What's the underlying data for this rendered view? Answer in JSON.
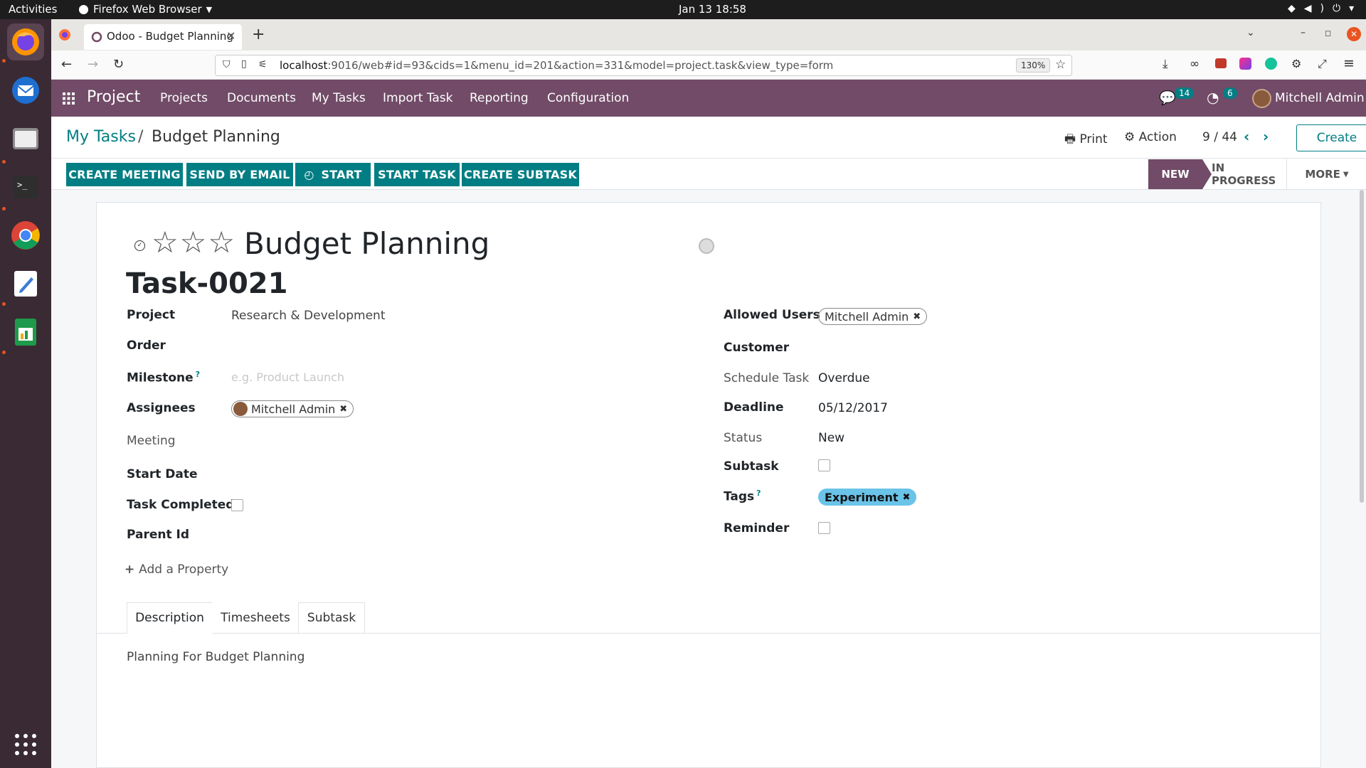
{
  "os": {
    "activities": "Activities",
    "app_name": "Firefox Web Browser",
    "datetime": "Jan 13  18:58"
  },
  "browser": {
    "tab_title": "Odoo - Budget Planning",
    "url_host": "localhost",
    "url_rest": ":9016/web#id=93&cids=1&menu_id=201&action=331&model=project.task&view_type=form",
    "zoom": "130%"
  },
  "odoo_nav": {
    "app": "Project",
    "items": [
      "Projects",
      "Documents",
      "My Tasks",
      "Import Task",
      "Reporting",
      "Configuration"
    ],
    "messages_count": "14",
    "activities_count": "6",
    "user": "Mitchell Admin"
  },
  "breadcrumb": {
    "parent": "My Tasks",
    "separator": "/",
    "current": "Budget Planning"
  },
  "toolbar": {
    "print": "Print",
    "action": "Action",
    "pager": "9 / 44",
    "create": "Create"
  },
  "buttons": {
    "create_meeting": "CREATE MEETING",
    "send_email": "SEND BY EMAIL",
    "start": "START",
    "start_task": "START TASK",
    "create_subtask": "CREATE SUBTASK"
  },
  "stages": {
    "new": "NEW",
    "in_progress": "IN PROGRESS",
    "more": "MORE"
  },
  "task": {
    "name": "Budget Planning",
    "reference": "Task-0021",
    "stars": 0
  },
  "left_fields": {
    "project_label": "Project",
    "project_value": "Research & Development",
    "order_label": "Order",
    "milestone_label": "Milestone",
    "milestone_placeholder": "e.g. Product Launch",
    "assignees_label": "Assignees",
    "assignee": "Mitchell Admin",
    "meeting_label": "Meeting",
    "start_date_label": "Start Date",
    "task_completed_label": "Task Completed",
    "parent_id_label": "Parent Id",
    "add_property": "Add a Property"
  },
  "right_fields": {
    "allowed_users_label": "Allowed Users",
    "allowed_user": "Mitchell Admin",
    "customer_label": "Customer",
    "schedule_label": "Schedule Task",
    "schedule_value": "Overdue",
    "deadline_label": "Deadline",
    "deadline_value": "05/12/2017",
    "status_label": "Status",
    "status_value": "New",
    "subtask_label": "Subtask",
    "tags_label": "Tags",
    "tag": "Experiment",
    "reminder_label": "Reminder"
  },
  "notebook": {
    "tabs": [
      "Description",
      "Timesheets",
      "Subtask"
    ],
    "description": "Planning For Budget Planning"
  },
  "colors": {
    "brand": "#714b67",
    "accent": "#017e84",
    "tag": "#6ac3e8"
  }
}
